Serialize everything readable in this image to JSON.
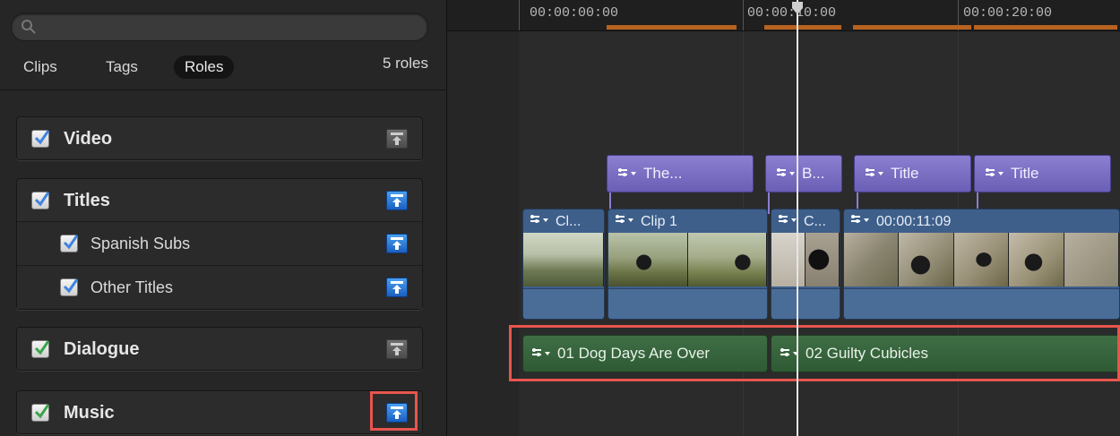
{
  "browser": {
    "tabs": [
      {
        "label": "Clips",
        "active": false
      },
      {
        "label": "Tags",
        "active": false
      },
      {
        "label": "Roles",
        "active": true
      }
    ],
    "role_count": "5 roles",
    "roles": [
      {
        "label": "Video",
        "checked": true,
        "check_color": "#3f84e0",
        "button": "gray",
        "subroles": []
      },
      {
        "label": "Titles",
        "checked": true,
        "check_color": "#3f84e0",
        "button": "blue",
        "subroles": [
          {
            "label": "Spanish Subs",
            "checked": true,
            "button": "blue"
          },
          {
            "label": "Other Titles",
            "checked": true,
            "button": "blue"
          }
        ]
      },
      {
        "label": "Dialogue",
        "checked": true,
        "check_color": "#3aa54a",
        "button": "gray",
        "subroles": []
      },
      {
        "label": "Music",
        "checked": true,
        "check_color": "#3aa54a",
        "button": "blue",
        "subroles": []
      }
    ]
  },
  "timeline": {
    "ruler": [
      "00:00:00:00",
      "00:00:10:00",
      "00:00:20:00"
    ],
    "titles": [
      "The...",
      "B...",
      "Title",
      "Title"
    ],
    "video_clips": [
      "Cl...",
      "Clip 1",
      "C...",
      "00:00:11:09"
    ],
    "music_clips": [
      "01 Dog Days Are Over",
      "02 Guilty Cubicles"
    ]
  },
  "colors": {
    "title_clip": "#7a6fc5",
    "video_clip": "#3e5f8a",
    "music_clip": "#3a6a42",
    "highlight": "#e8554e",
    "role_button_active": "#2f7fdc"
  }
}
